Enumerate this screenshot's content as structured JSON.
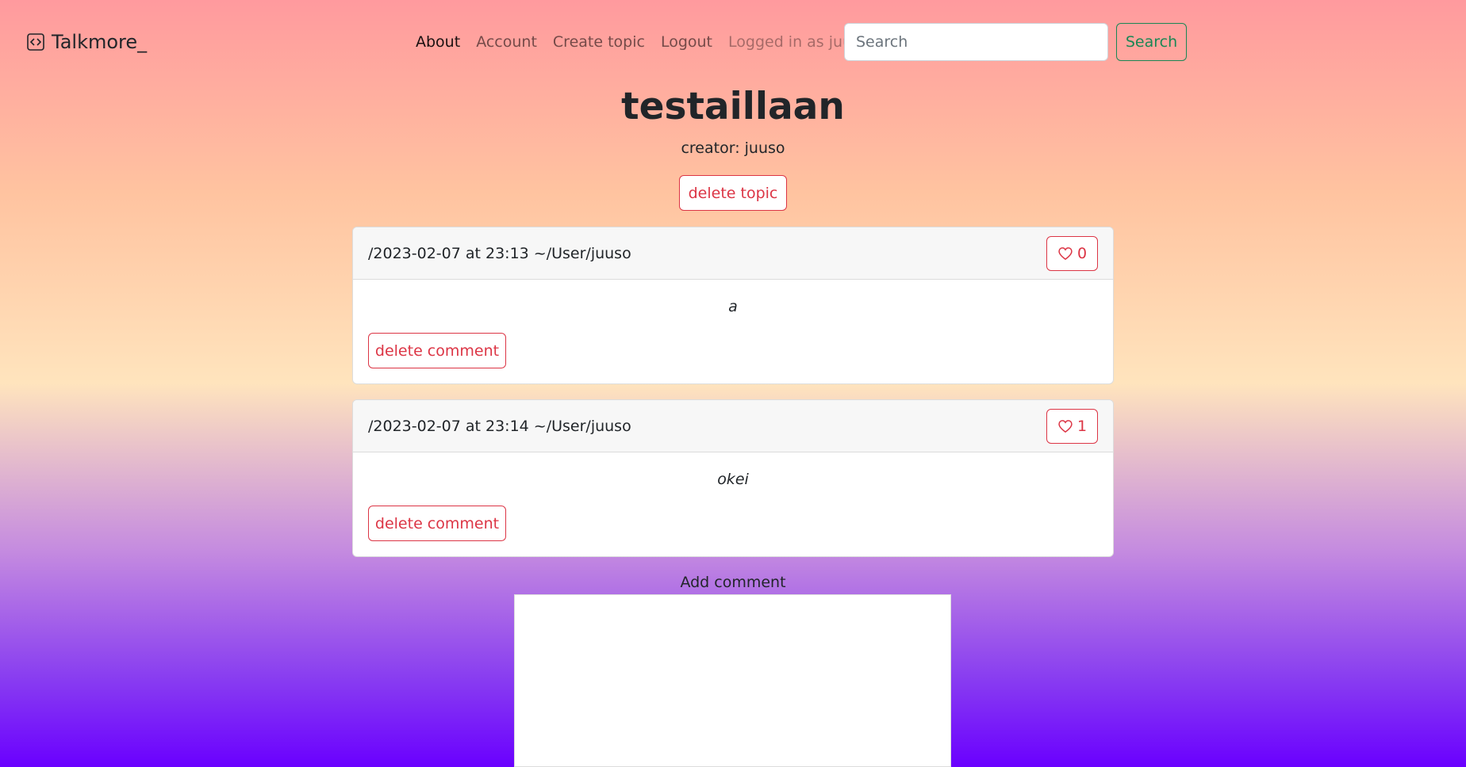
{
  "brand": {
    "name": "Talkmore_",
    "icon": "code-square-icon"
  },
  "nav": {
    "items": [
      {
        "label": "About",
        "active": true
      },
      {
        "label": "Account",
        "active": false
      },
      {
        "label": "Create topic",
        "active": false
      },
      {
        "label": "Logout",
        "active": false
      }
    ],
    "status_text": "Logged in as juuso"
  },
  "search": {
    "placeholder": "Search",
    "value": "",
    "button_label": "Search"
  },
  "topic": {
    "title": "testaillaan",
    "creator": "creator: juuso",
    "delete_label": "delete topic"
  },
  "comments": [
    {
      "meta": "/2023-02-07 at 23:13 ~/User/juuso",
      "likes": "0",
      "like_icon": "heart-icon",
      "text": "a",
      "delete_label": "delete comment"
    },
    {
      "meta": "/2023-02-07 at 23:14 ~/User/juuso",
      "likes": "1",
      "like_icon": "heart-icon",
      "text": "okei",
      "delete_label": "delete comment"
    }
  ],
  "add_comment": {
    "label": "Add comment",
    "value": ""
  },
  "colors": {
    "danger": "#dc3545",
    "success": "#198754",
    "gradient_top": "#ff9a9e",
    "gradient_mid": "#ffe4bd",
    "gradient_bottom": "#6a00ff"
  }
}
